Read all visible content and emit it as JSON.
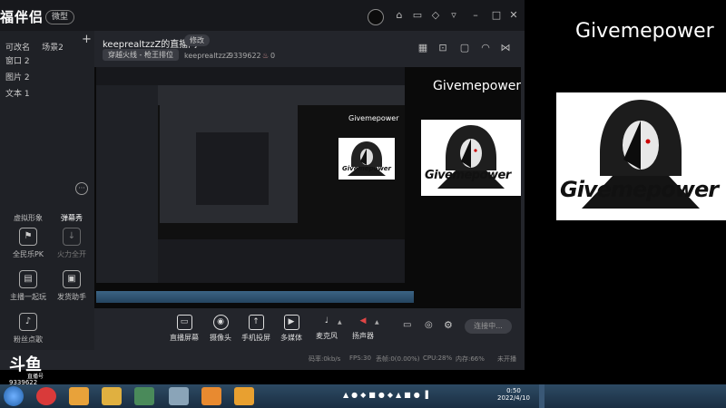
{
  "app": {
    "logo_text": "福伴侣",
    "version_badge": "微型",
    "titlebar_icons": [
      "avatar",
      "gift-icon",
      "message-icon",
      "shirt-icon",
      "bell-icon",
      "minimize-icon",
      "maximize-icon",
      "close-icon"
    ]
  },
  "sidebar": {
    "tabs": [
      "可改名",
      "场景2"
    ],
    "add_label": "+",
    "scene_items": [
      "窗口 2",
      "图片 2",
      "文本 1"
    ],
    "row1": [
      {
        "label": "虚拟形象",
        "icon": "avatar-icon"
      },
      {
        "label": "弹幕秀",
        "icon": "chat-icon"
      }
    ],
    "row2": [
      {
        "label": "全民乐PK",
        "icon": "pk-icon"
      },
      {
        "label": "火力全开",
        "icon": "download-icon"
      }
    ],
    "row3": [
      {
        "label": "主播一起玩",
        "icon": "flag-icon"
      },
      {
        "label": "发货助手",
        "icon": "box-icon"
      }
    ],
    "row4": [
      {
        "label": "粉丝点歌",
        "icon": "mic-icon"
      }
    ]
  },
  "header": {
    "room_title": "keeprealtzzZ的直播间",
    "edit_label": "修改",
    "game_tag": "穿越火线 - 枪王排位",
    "username": "keeprealtzzZ",
    "room_id": "9339622",
    "heat": "0"
  },
  "preview": {
    "nested_title": "Givemepower",
    "nested_logo_text": "Givemepower"
  },
  "toolbar": {
    "items": [
      {
        "label": "直播屏幕",
        "icon": "screen-icon"
      },
      {
        "label": "摄像头",
        "icon": "camera-icon"
      },
      {
        "label": "手机投屏",
        "icon": "phone-icon"
      },
      {
        "label": "多媒体",
        "icon": "media-icon"
      },
      {
        "label": "麦克风",
        "icon": "mic-icon"
      },
      {
        "label": "扬声器",
        "icon": "speaker-icon"
      }
    ],
    "live_button": "连接中..."
  },
  "status": {
    "bitrate": "码率:0kb/s",
    "fps": "FPS:30",
    "dropped": "丢帧:0(0.00%)",
    "cpu": "CPU:28%",
    "memory": "内存:66%",
    "live_state": "未开播"
  },
  "watermark": {
    "brand": "斗鱼",
    "sub": "直播号",
    "room": "9339622"
  },
  "taskbar": {
    "time": "0:50",
    "date": "2022/4/10"
  },
  "right_panel": {
    "title": "Givemepower",
    "logo_text": "Givemepower"
  },
  "colors": {
    "app_bg": "#23252b",
    "titlebar": "#17181c",
    "taskbar": "#1a2e42",
    "accent_red": "#d93a3a"
  }
}
